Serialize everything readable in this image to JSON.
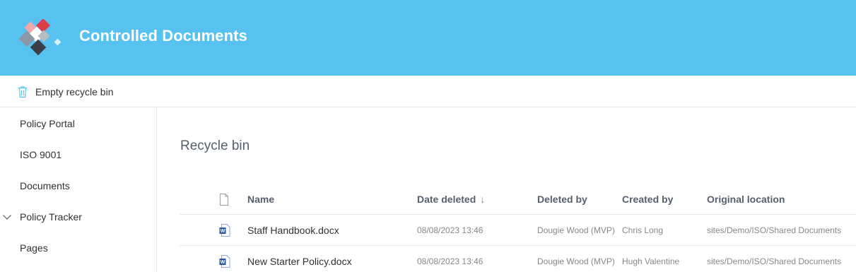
{
  "app": {
    "title": "Controlled Documents",
    "header_color": "#57c2f0"
  },
  "commandbar": {
    "empty_label": "Empty recycle bin",
    "empty_icon": "trash-icon"
  },
  "nav": {
    "items": [
      {
        "label": "Policy Portal"
      },
      {
        "label": "ISO 9001"
      },
      {
        "label": "Documents"
      },
      {
        "label": "Policy Tracker",
        "expandable": true,
        "icon": "chevron-down-icon"
      },
      {
        "label": "Pages"
      }
    ]
  },
  "main": {
    "page_title": "Recycle bin",
    "columns": {
      "type_icon": "file-icon",
      "name": "Name",
      "date_deleted": "Date deleted",
      "sort_indicator": "↓",
      "deleted_by": "Deleted by",
      "created_by": "Created by",
      "original_location": "Original location"
    },
    "rows": [
      {
        "icon": "word-doc-icon",
        "name": "Staff Handbook.docx",
        "date_deleted": "08/08/2023 13:46",
        "deleted_by": "Dougie Wood (MVP)",
        "created_by": "Chris Long",
        "original_location": "sites/Demo/ISO/Shared Documents"
      },
      {
        "icon": "word-doc-icon",
        "name": "New Starter Policy.docx",
        "date_deleted": "08/08/2023 13:46",
        "deleted_by": "Dougie Wood (MVP)",
        "created_by": "Hugh Valentine",
        "original_location": "sites/Demo/ISO/Shared Documents"
      }
    ]
  }
}
